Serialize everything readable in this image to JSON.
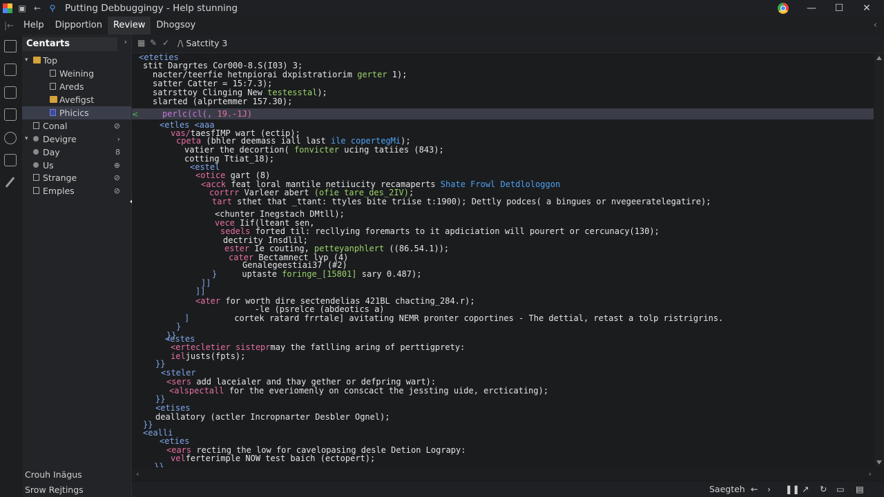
{
  "titlebar": {
    "title": "Putting Debbuggingy - Help stunning"
  },
  "menubar": {
    "items": [
      "Help",
      "Dipportion",
      "Review",
      "Dhogsoy"
    ],
    "active_index": 2
  },
  "sidebar": {
    "header": "Centarts",
    "header_caret": "›",
    "tree": [
      {
        "label": "Top",
        "twist": "▾",
        "right": ""
      },
      {
        "label": "Weining",
        "twist": "",
        "right": ""
      },
      {
        "label": "Areds",
        "twist": "",
        "right": ""
      },
      {
        "label": "Avefigst",
        "twist": "",
        "right": ""
      },
      {
        "label": "Phicics",
        "twist": "",
        "right": ""
      },
      {
        "label": "Conal",
        "twist": "",
        "right": "⊘"
      },
      {
        "label": "Devigre",
        "twist": "▾",
        "right": "›"
      },
      {
        "label": "Day",
        "twist": "",
        "right": "8"
      },
      {
        "label": "Us",
        "twist": "",
        "right": "⊕"
      },
      {
        "label": "Strange",
        "twist": "",
        "right": "⊘"
      },
      {
        "label": "Emples",
        "twist": "",
        "right": "⊘"
      }
    ],
    "footer": [
      "Crouh Inägus",
      "Srow Rejtings"
    ]
  },
  "editor_toolbar": {
    "tab_label": "Satctity 3"
  },
  "code": [
    {
      "segs": [
        [
          "tag",
          "<eteties"
        ]
      ]
    },
    {
      "segs": [
        [
          "",
          "stit Dargrtes Cor000-8.S(I03) 3;"
        ]
      ]
    },
    {
      "segs": [
        [
          "",
          "nacter/teerfie hetnpiorai dxpistratiorim "
        ],
        [
          "green",
          "gerter"
        ],
        [
          "",
          " 1);"
        ]
      ]
    },
    {
      "segs": [
        [
          "",
          "satter Catter = 15:7.3);"
        ]
      ]
    },
    {
      "segs": [
        [
          "",
          "satrsttoy Clinging New "
        ],
        [
          "green",
          "testesstal"
        ],
        [
          "",
          ");"
        ]
      ]
    },
    {
      "segs": [
        [
          "",
          "slarted (alprtemmer 157.30);"
        ]
      ]
    },
    {
      "segs": [
        [
          "purple",
          "perlc(cl(,"
        ],
        [
          "pink",
          " 19.-1J)"
        ]
      ]
    },
    {
      "segs": [
        [
          "tag",
          "<etles <aaa"
        ]
      ]
    },
    {
      "segs": [
        [
          "pink",
          "vas/"
        ],
        [
          "",
          "taesfIMP wart (ectip);"
        ]
      ]
    },
    {
      "segs": [
        [
          "pink",
          "cpeta"
        ],
        [
          "",
          " (bhler deemass iall last "
        ],
        [
          "blue",
          "ile copertegMi"
        ],
        [
          "",
          ");"
        ]
      ]
    },
    {
      "segs": [
        [
          "",
          "vatier the decortion( "
        ],
        [
          "green",
          "fonvicter"
        ],
        [
          "",
          " ucing tatiies (843);"
        ]
      ]
    },
    {
      "segs": [
        [
          "",
          "cotting Ttiat_18);"
        ]
      ]
    },
    {
      "segs": [
        [
          "tag",
          "<estel"
        ]
      ]
    },
    {
      "segs": [
        [
          "pink",
          "<otice"
        ],
        [
          "",
          " gart (8)"
        ]
      ]
    },
    {
      "segs": [
        [
          "pink",
          "<acck"
        ],
        [
          "",
          " feat loral mantile netiiucity recamaperts "
        ],
        [
          "blue",
          "Shate Frowl Detdlologgon"
        ]
      ]
    },
    {
      "segs": [
        [
          "pink",
          "cortrr"
        ],
        [
          "",
          " Varleer abert "
        ],
        [
          "green",
          "(ofie tare_des_2IV)"
        ],
        [
          "",
          ";"
        ]
      ]
    },
    {
      "segs": [
        [
          "pink",
          "tart"
        ],
        [
          "",
          " sthet that _ttant: ttyles bite triise t:1900); Dettly podces( a bingues or nvegeeratelegatire);"
        ]
      ]
    },
    {
      "segs": [
        [
          "",
          "<chunter Inegstach DMtll);"
        ]
      ]
    },
    {
      "segs": [
        [
          "pink",
          "vece"
        ],
        [
          "",
          " Iif(lteant sen,"
        ]
      ]
    },
    {
      "segs": [
        [
          "pink",
          "sedels"
        ],
        [
          "",
          " forted til: recllying foremarts to it apdiciation will pourert or cercunacy(130);"
        ]
      ]
    },
    {
      "segs": [
        [
          "",
          "dectrity Insdlil;"
        ]
      ]
    },
    {
      "segs": [
        [
          "pink",
          "ester"
        ],
        [
          "",
          " Ie couting, "
        ],
        [
          "green",
          "petteyanphlert"
        ],
        [
          "",
          " ((86.54.1));"
        ]
      ]
    },
    {
      "segs": [
        [
          "pink",
          "cater"
        ],
        [
          "",
          " Bectamnect lyp (4)"
        ]
      ]
    },
    {
      "segs": [
        [
          "",
          "Genalegeestiai37 (#2)"
        ]
      ]
    },
    {
      "segs": [
        [
          "tag",
          "}"
        ],
        [
          "",
          "     uptaste "
        ],
        [
          "green",
          "foringe_[15801]"
        ],
        [
          "",
          " sary 0.487);"
        ]
      ]
    },
    {
      "segs": [
        [
          "tag",
          "]]"
        ]
      ]
    },
    {
      "segs": [
        [
          "tag",
          "]]"
        ]
      ]
    },
    {
      "segs": [
        [
          "pink",
          "<ater"
        ],
        [
          "",
          " for worth dire sectendelias 421BL chacting_284.r);"
        ]
      ]
    },
    {
      "segs": [
        [
          "",
          "   -le (psrelce (abdeotics a)"
        ]
      ]
    },
    {
      "segs": [
        [
          "tag",
          "]"
        ],
        [
          "",
          "         cortek ratard frrtale] avitating NEMR pronter coportines - The dettial, retast a tolp ristrigrins."
        ]
      ]
    },
    {
      "segs": [
        [
          "tag",
          "}"
        ]
      ]
    },
    {
      "segs": [
        [
          "tag",
          "}}"
        ]
      ]
    },
    {
      "segs": [
        [
          "tag",
          "<estes"
        ]
      ]
    },
    {
      "segs": [
        [
          "pink",
          "<ertecletier"
        ],
        [
          "",
          " "
        ],
        [
          "pink",
          "sistepr"
        ],
        [
          "",
          "may the fatlling aring of perttigprety:"
        ]
      ]
    },
    {
      "segs": [
        [
          "pink",
          "iel"
        ],
        [
          "",
          "justs(fpts);"
        ]
      ]
    },
    {
      "segs": [
        [
          "tag",
          "}}"
        ]
      ]
    },
    {
      "segs": [
        [
          "tag",
          "<steler"
        ]
      ]
    },
    {
      "segs": [
        [
          "pink",
          "<sers"
        ],
        [
          "",
          " add laceialer and thay gether or defpring wart):"
        ]
      ]
    },
    {
      "segs": [
        [
          "pink",
          "<alspectall"
        ],
        [
          "",
          " for the everiomenly on conscact the jessting uide, ercticating);"
        ]
      ]
    },
    {
      "segs": [
        [
          "tag",
          "}}"
        ]
      ]
    },
    {
      "segs": [
        [
          "tag",
          "<etises"
        ]
      ]
    },
    {
      "segs": [
        [
          "",
          "deallatory (actler Incropnarter Desbler Ognel);"
        ]
      ]
    },
    {
      "segs": [
        [
          "tag",
          "}}"
        ]
      ]
    },
    {
      "segs": [
        [
          "tag",
          "<ealli"
        ]
      ]
    },
    {
      "segs": [
        [
          "tag",
          "<eties"
        ]
      ]
    },
    {
      "segs": [
        [
          "pink",
          "<ears"
        ],
        [
          "",
          " recting the low for cavelopasing desle Detion Lograpy:"
        ]
      ]
    },
    {
      "segs": [
        [
          "pink",
          "vel"
        ],
        [
          "",
          "ferterimple NOW test baich (ectopert);"
        ]
      ]
    },
    {
      "segs": [
        [
          "tag",
          "}}"
        ]
      ]
    }
  ],
  "statusbar": {
    "search_label": "Saegteh"
  },
  "colors": {
    "accent": "#3a3d4a",
    "highlight_line": "#3a3d47",
    "tag": "#7ea6e8",
    "keyword": "#e66fa3",
    "string": "#9bd36b",
    "link": "#4ea1f3"
  }
}
